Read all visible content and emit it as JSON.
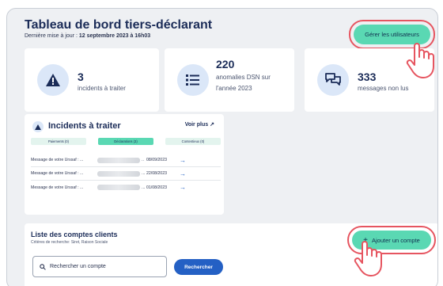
{
  "dashboard": {
    "title": "Tableau de bord tiers-déclarant",
    "last_update_prefix": "Dernière mise à jour : ",
    "last_update_value": "12 septembre 2023 à 16h03",
    "manage_users_label": "Gérer les utilisateurs"
  },
  "stats": [
    {
      "value": "3",
      "label": "incidents à traiter",
      "icon": "warning-icon"
    },
    {
      "value": "220",
      "label_line1": "anomalies DSN sur",
      "label_line2": "l'année 2023",
      "icon": "list-icon"
    },
    {
      "value": "333",
      "label": "messages non lus",
      "icon": "chat-icon"
    }
  ],
  "incidents": {
    "title": "Incidents à traiter",
    "see_more": "Voir plus",
    "tabs": [
      "Paiements (0)",
      "Déclarations (3)",
      "Contentieux (0)"
    ],
    "active_tab": 1,
    "rows": [
      {
        "message": "Message de votre Urssaf : ...",
        "dots": "..",
        "date": "08/09/2023"
      },
      {
        "message": "Message de votre Urssaf : ...",
        "dots": "...",
        "date": "22/08/2023"
      },
      {
        "message": "Message de votre Urssaf : ...",
        "dots": "...",
        "date": "01/08/2023"
      }
    ]
  },
  "clients": {
    "title": "Liste des comptes clients",
    "criteria": "Critères de recherche: Siret, Raison Sociale",
    "search_placeholder": "Rechercher un compte",
    "search_button": "Rechercher",
    "add_account_label": "Ajouter un compte"
  },
  "colors": {
    "accent_green": "#5ad8b3",
    "primary_blue": "#2460c4",
    "highlight_red": "#e65560",
    "title_navy": "#1b2c58"
  }
}
